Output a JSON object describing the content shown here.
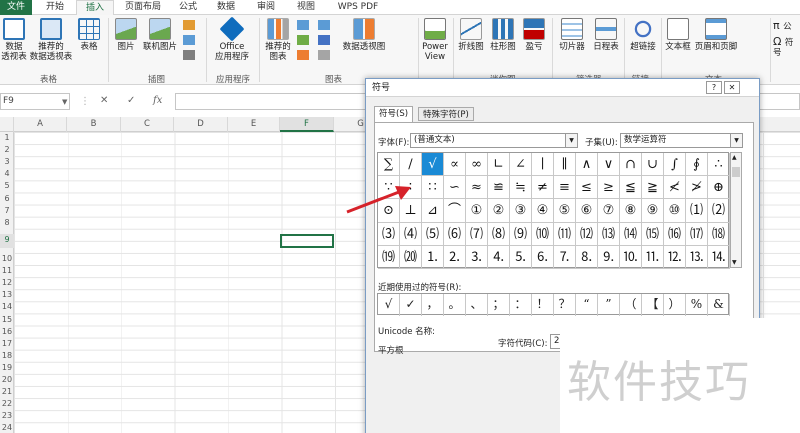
{
  "tabs": [
    "文件",
    "开始",
    "插入",
    "页面布局",
    "公式",
    "数据",
    "审阅",
    "视图",
    "WPS PDF"
  ],
  "ribbon": {
    "buttons": {
      "pivot": "数据\n透视表",
      "rec_pivot": "推荐的\n数据透视表",
      "table": "表格",
      "picture": "图片",
      "online_picture": "联机图片",
      "office_apps": "Office\n应用程序",
      "rec_charts": "推荐的\n图表",
      "pivot_chart": "数据透视图",
      "power_view": "Power\nView",
      "line": "折线图",
      "column": "柱形图",
      "winloss": "盈亏",
      "slicer": "切片器",
      "timeline": "日程表",
      "hyperlink": "超链接",
      "textbox": "文本框",
      "header_footer": "页眉和页脚",
      "formula_cut": "公",
      "symbol_cut": "符号"
    },
    "groups": {
      "tables": "表格",
      "illustrations": "插图",
      "apps": "应用程序",
      "charts": "图表",
      "sparklines": "迷你图",
      "filter": "筛选器",
      "links": "链接",
      "text": "文本"
    }
  },
  "formula_bar": {
    "name_box": "F9",
    "cancel": "✕",
    "enter": "✓",
    "fx": "fx"
  },
  "columns": [
    "A",
    "B",
    "C",
    "D",
    "E",
    "F",
    "G"
  ],
  "rows": [
    "1",
    "2",
    "3",
    "4",
    "5",
    "6",
    "7",
    "8",
    "9",
    "10",
    "11",
    "12",
    "13",
    "14",
    "15",
    "16",
    "17",
    "18",
    "19",
    "20",
    "21",
    "22",
    "23",
    "24"
  ],
  "dialog": {
    "title": "符号",
    "help": "?",
    "close": "✕",
    "tab_symbols": "符号(S)",
    "tab_special": "特殊字符(P)",
    "font_label": "字体(F):",
    "font_value": "(普通文本)",
    "subset_label": "子集(U):",
    "subset_value": "数学运算符",
    "symbols": [
      [
        "∑",
        "∕",
        "√",
        "∝",
        "∞",
        "∟",
        "∠",
        "∣",
        "∥",
        "∧",
        "∨",
        "∩",
        "∪",
        "∫",
        "∮",
        "∴"
      ],
      [
        "∵",
        "∶",
        "∷",
        "∽",
        "≈",
        "≌",
        "≒",
        "≠",
        "≡",
        "≤",
        "≥",
        "≦",
        "≧",
        "≮",
        "≯",
        "⊕"
      ],
      [
        "⊙",
        "⊥",
        "⊿",
        "⌒",
        "①",
        "②",
        "③",
        "④",
        "⑤",
        "⑥",
        "⑦",
        "⑧",
        "⑨",
        "⑩",
        "⑴",
        "⑵"
      ],
      [
        "⑶",
        "⑷",
        "⑸",
        "⑹",
        "⑺",
        "⑻",
        "⑼",
        "⑽",
        "⑾",
        "⑿",
        "⒀",
        "⒁",
        "⒂",
        "⒃",
        "⒄",
        "⒅"
      ],
      [
        "⒆",
        "⒇",
        "⒈",
        "⒉",
        "⒊",
        "⒋",
        "⒌",
        "⒍",
        "⒎",
        "⒏",
        "⒐",
        "⒑",
        "⒒",
        "⒓",
        "⒔",
        "⒕"
      ]
    ],
    "selected_symbol": "√",
    "recent_label": "近期使用过的符号(R):",
    "recent": [
      "√",
      "✓",
      "，",
      "。",
      "、",
      "；",
      "：",
      "！",
      "？",
      "“",
      "”",
      "（",
      "【",
      "）",
      "%",
      "&"
    ],
    "unicode_name_label": "Unicode 名称:",
    "unicode_name": "平方根",
    "char_code_label": "字符代码(C):",
    "char_code": "221A"
  },
  "watermark": "软件技巧"
}
